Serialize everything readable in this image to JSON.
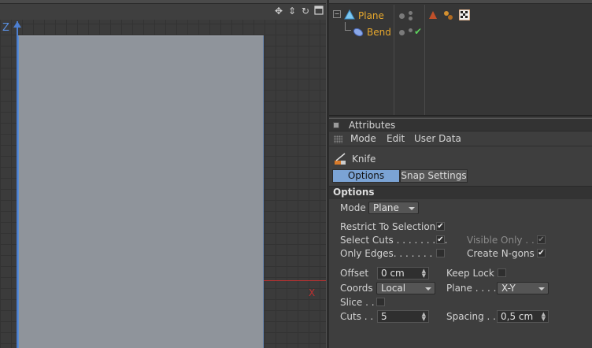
{
  "viewport": {
    "axis_z": "Z",
    "axis_x": "X",
    "nav_icons": [
      "move-icon",
      "zoom-icon",
      "rotate-icon",
      "maximize-icon"
    ]
  },
  "objects": {
    "rows": [
      {
        "name": "Plane",
        "icon": "plane-icon",
        "check": ""
      },
      {
        "name": "Bend",
        "icon": "bend-deformer-icon",
        "check": "✔"
      }
    ],
    "tags": [
      "phong-tag-icon",
      "texture-tag-icon",
      "material-checker-icon"
    ]
  },
  "attributes": {
    "title": "Attributes",
    "menu": [
      "Mode",
      "Edit",
      "User Data"
    ],
    "tool_name": "Knife",
    "tabs": [
      "Options",
      "Snap Settings"
    ],
    "section": "Options",
    "mode_label": "Mode",
    "mode_value": "Plane",
    "restrict_label": "Restrict To Selection",
    "restrict_check": "✔",
    "select_cuts_label": "Select Cuts . . . . . . . . .",
    "select_cuts_check": "✔",
    "visible_only_label": "Visible Only . .",
    "visible_only_check": "✔",
    "only_edges_label": "Only Edges. . . . . . . . .",
    "only_edges_check": "",
    "create_ngons_label": "Create N-gons",
    "create_ngons_check": "✔",
    "offset_label": "Offset",
    "offset_value": "0 cm",
    "keep_lock_label": "Keep Lock",
    "keep_lock_check": "",
    "coords_label": "Coords",
    "coords_value": "Local",
    "plane_label": "Plane . . . .",
    "plane_value": "X-Y",
    "slice_label": "Slice . .",
    "slice_check": "",
    "cuts_label": "Cuts . .",
    "cuts_value": "5",
    "spacing_label": "Spacing . .",
    "spacing_value": "0,5 cm"
  }
}
